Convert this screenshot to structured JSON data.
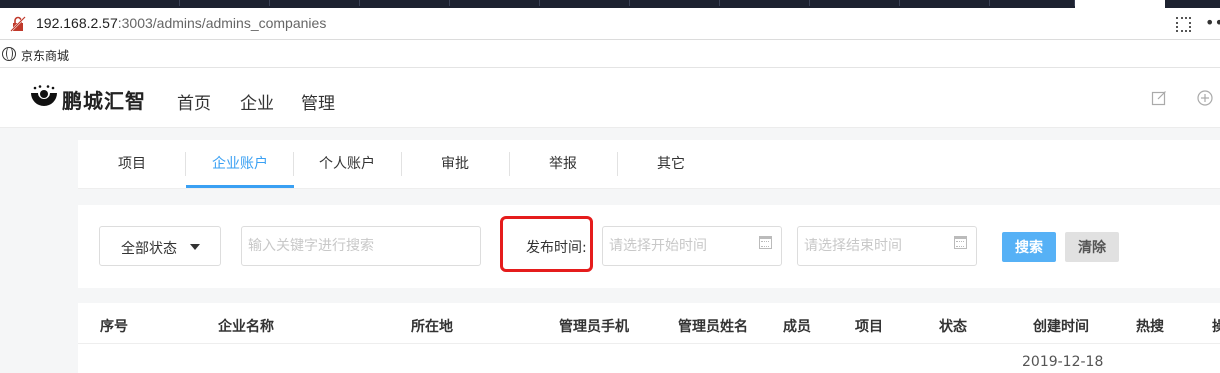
{
  "browser": {
    "url_host": "192.168.2.57",
    "url_rest": ":3003/admins/admins_companies",
    "bookmark_label": "京东商城"
  },
  "app": {
    "brand": "鹏城汇智",
    "nav": [
      "首页",
      "企业",
      "管理"
    ]
  },
  "tabs": [
    {
      "label": "项目",
      "active": false
    },
    {
      "label": "企业账户",
      "active": true
    },
    {
      "label": "个人账户",
      "active": false
    },
    {
      "label": "审批",
      "active": false
    },
    {
      "label": "举报",
      "active": false
    },
    {
      "label": "其它",
      "active": false
    }
  ],
  "filters": {
    "status_value": "全部状态",
    "keyword_placeholder": "输入关键字进行搜索",
    "publish_time_label": "发布时间:",
    "start_placeholder": "请选择开始时间",
    "end_placeholder": "请选择结束时间",
    "search_label": "搜索",
    "clear_label": "清除"
  },
  "table": {
    "headers": [
      "序号",
      "企业名称",
      "所在地",
      "管理员手机",
      "管理员姓名",
      "成员",
      "项目",
      "状态",
      "创建时间",
      "热搜",
      "操"
    ],
    "first_row_date": "2019-12-18"
  },
  "colors": {
    "accent": "#3aa0f3",
    "highlight": "#e51c1c",
    "search_button": "#56b1f6"
  }
}
